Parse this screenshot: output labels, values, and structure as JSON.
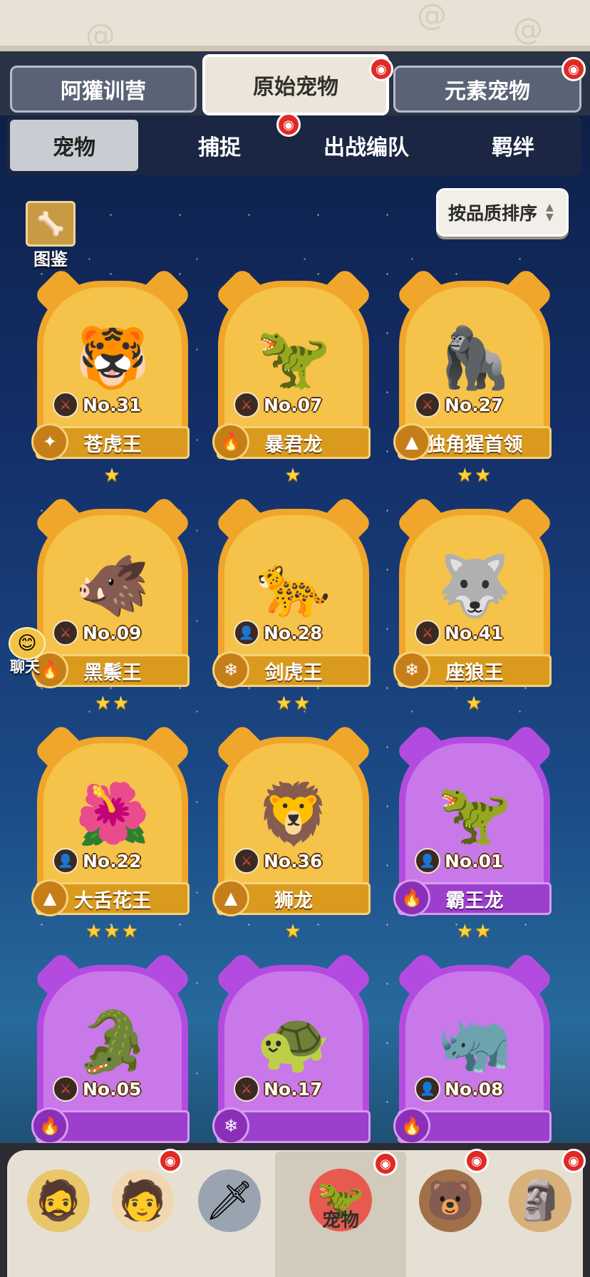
{
  "top_tabs": [
    {
      "label": "阿獾训营",
      "active": false,
      "has_alert": false
    },
    {
      "label": "原始宠物",
      "active": true,
      "has_alert": true
    },
    {
      "label": "元素宠物",
      "active": false,
      "has_alert": true
    }
  ],
  "sub_tabs": [
    {
      "label": "宠物",
      "active": true,
      "has_alert": false
    },
    {
      "label": "捕捉",
      "active": false,
      "has_alert": true
    },
    {
      "label": "出战编队",
      "active": false,
      "has_alert": false
    },
    {
      "label": "羁绊",
      "active": false,
      "has_alert": false
    }
  ],
  "codex": {
    "label": "图鉴",
    "icon": "codex-scroll-icon"
  },
  "sort_button": {
    "label": "按品质排序",
    "icon": "sort-arrows-icon"
  },
  "chat": {
    "label": "聊天",
    "icon": "chat-bubble-icon"
  },
  "pets": [
    {
      "no": "No.31",
      "name": "苍虎王",
      "stars": "★",
      "type_icon": "sword-icon",
      "element": "poison",
      "rarity": "orange",
      "emblem": "🐯"
    },
    {
      "no": "No.07",
      "name": "暴君龙",
      "stars": "★",
      "type_icon": "sword-icon",
      "element": "fire",
      "rarity": "orange",
      "emblem": "🦖"
    },
    {
      "no": "No.27",
      "name": "独角猩首领",
      "stars": "★★",
      "type_icon": "sword-icon",
      "element": "earth",
      "rarity": "orange",
      "emblem": "🦍"
    },
    {
      "no": "No.09",
      "name": "黑鬃王",
      "stars": "★★",
      "type_icon": "sword-icon",
      "element": "fire",
      "rarity": "orange",
      "emblem": "🐗"
    },
    {
      "no": "No.28",
      "name": "剑虎王",
      "stars": "★★",
      "type_icon": "user-icon",
      "element": "ice",
      "rarity": "orange",
      "emblem": "🐆"
    },
    {
      "no": "No.41",
      "name": "座狼王",
      "stars": "★",
      "type_icon": "sword-icon",
      "element": "ice",
      "rarity": "orange",
      "emblem": "🐺"
    },
    {
      "no": "No.22",
      "name": "大舌花王",
      "stars": "★★★",
      "type_icon": "user-icon",
      "element": "earth",
      "rarity": "orange",
      "emblem": "🌺"
    },
    {
      "no": "No.36",
      "name": "狮龙",
      "stars": "★",
      "type_icon": "sword-icon",
      "element": "earth",
      "rarity": "orange",
      "emblem": "🦁"
    },
    {
      "no": "No.01",
      "name": "霸王龙",
      "stars": "★★",
      "type_icon": "user-icon",
      "element": "fire",
      "rarity": "purple",
      "emblem": "🦖"
    },
    {
      "no": "No.05",
      "name": "",
      "stars": "",
      "type_icon": "sword-icon",
      "element": "fire",
      "rarity": "purple",
      "emblem": "🐊"
    },
    {
      "no": "No.17",
      "name": "",
      "stars": "",
      "type_icon": "sword-icon",
      "element": "ice",
      "rarity": "purple",
      "emblem": "🐢"
    },
    {
      "no": "No.08",
      "name": "",
      "stars": "",
      "type_icon": "user-icon",
      "element": "fire",
      "rarity": "purple",
      "emblem": "🦏"
    }
  ],
  "bottom_nav": [
    {
      "label": "",
      "icon": "caveman-icon",
      "active": false,
      "has_alert": false
    },
    {
      "label": "",
      "icon": "hero-icon",
      "active": false,
      "has_alert": true
    },
    {
      "label": "",
      "icon": "weapon-icon",
      "active": false,
      "has_alert": false
    },
    {
      "label": "宠物",
      "icon": "pet-dino-icon",
      "active": true,
      "has_alert": true
    },
    {
      "label": "",
      "icon": "tribe-icon",
      "active": false,
      "has_alert": true
    },
    {
      "label": "",
      "icon": "totem-icon",
      "active": false,
      "has_alert": true
    }
  ],
  "colors": {
    "gold_frame": "#f0a62a",
    "purple_frame": "#b44be0",
    "alert": "#e02a25",
    "star": "#ffd23a"
  }
}
